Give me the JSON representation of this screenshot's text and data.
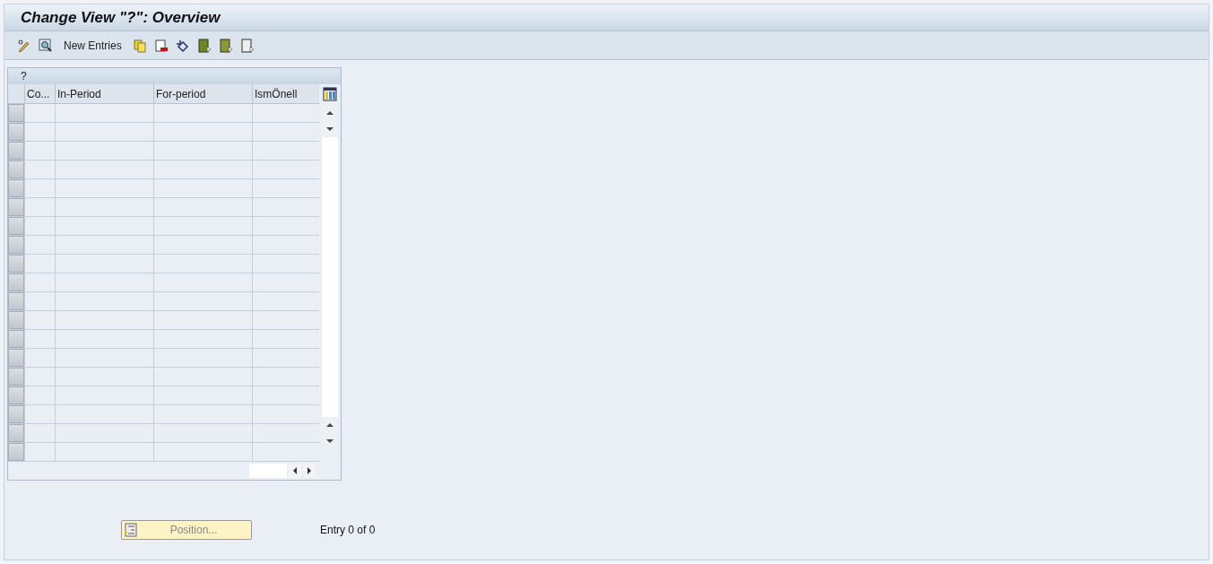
{
  "window": {
    "title": "Change View \"?\": Overview"
  },
  "toolbar": {
    "new_entries": "New Entries"
  },
  "table": {
    "title": "?",
    "columns": [
      "Co...",
      "In-Period",
      "For-period",
      "IsmÖnell"
    ]
  },
  "footer": {
    "position_button": "Position...",
    "entry_count": "Entry 0 of 0"
  }
}
